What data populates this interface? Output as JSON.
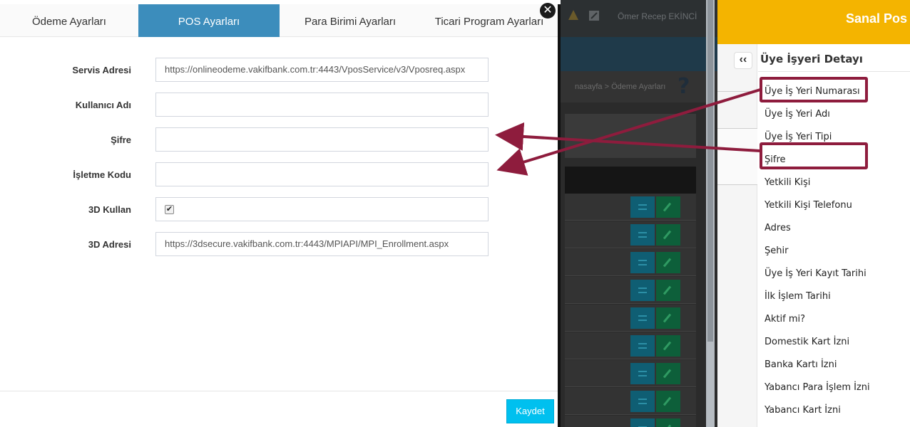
{
  "colors": {
    "tab_active": "#3c8dbc",
    "save_button": "#00c0ef",
    "brand_bar": "#f4b400",
    "annotation": "#8e1c3d"
  },
  "modal": {
    "tabs": [
      {
        "label": "Ödeme Ayarları",
        "active": false
      },
      {
        "label": "POS Ayarları",
        "active": true
      },
      {
        "label": "Para Birimi Ayarları",
        "active": false
      },
      {
        "label": "Ticari Program Ayarları",
        "active": false
      }
    ],
    "close_icon": "close-icon",
    "fields": [
      {
        "label": "Servis Adresi",
        "value": "https://onlineodeme.vakifbank.com.tr:4443/VposService/v3/Vposreq.aspx"
      },
      {
        "label": "Kullanıcı Adı",
        "value": ""
      },
      {
        "label": "Şifre",
        "value": ""
      },
      {
        "label": "İşletme Kodu",
        "value": ""
      },
      {
        "label": "3D Kullan",
        "checked": true
      },
      {
        "label": "3D Adresi",
        "value": "https://3dsecure.vakifbank.com.tr:4443/MPIAPI/MPI_Enrollment.aspx"
      }
    ],
    "save_label": "Kaydet"
  },
  "background_app": {
    "user_name": "Ömer Recep EKİNCİ",
    "breadcrumb": "nasayfa  >  Ödeme Ayarları",
    "help_icon": "?"
  },
  "right_panel": {
    "brand": "Sanal Pos",
    "collapse_icon": "‹‹",
    "title": "Üye İşyeri Detayı",
    "items": [
      "Üye İş Yeri Numarası",
      "Üye İş Yeri Adı",
      "Üye İş Yeri Tipi",
      "Şifre",
      "Yetkili Kişi",
      "Yetkili Kişi Telefonu",
      "Adres",
      "Şehir",
      "Üye İş Yeri Kayıt Tarihi",
      "İlk İşlem Tarihi",
      "Aktif mi?",
      "Domestik Kart İzni",
      "Banka Kartı İzni",
      "Yabancı Para İşlem İzni",
      "Yabancı Kart İzni"
    ]
  }
}
